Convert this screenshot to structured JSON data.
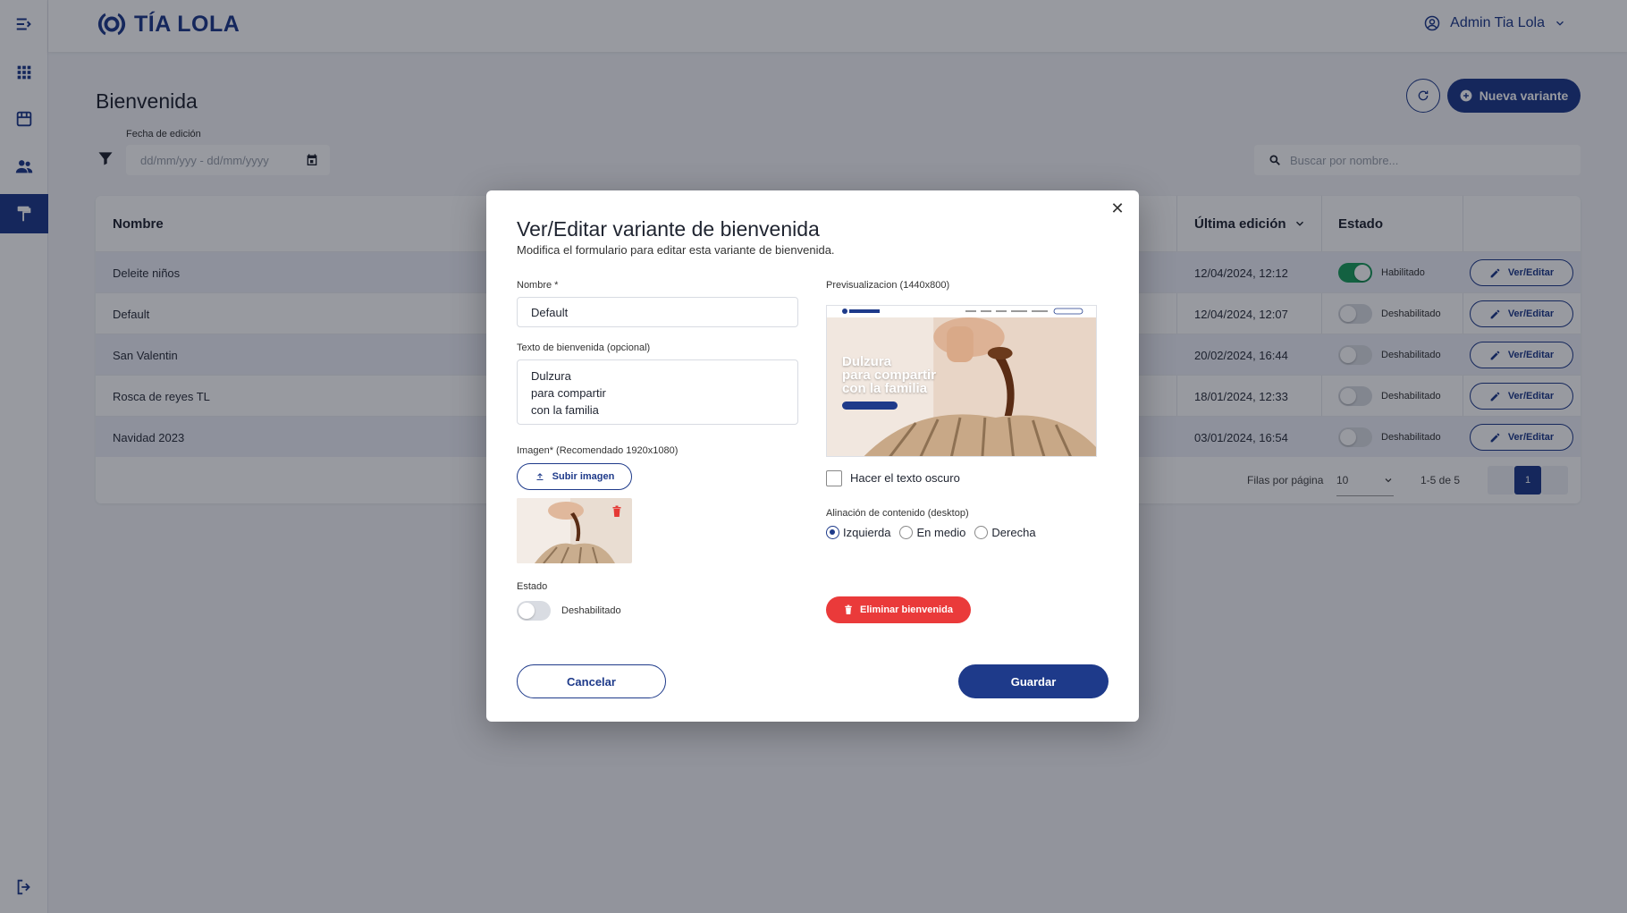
{
  "app": {
    "brand": "TÍA LOLA",
    "user_name": "Admin Tia Lola"
  },
  "sidebar": {
    "items": [
      {
        "icon": "menu-collapse-icon"
      },
      {
        "icon": "grid-icon"
      },
      {
        "icon": "store-icon"
      },
      {
        "icon": "users-icon"
      },
      {
        "icon": "paint-roller-icon",
        "active": true
      },
      {
        "icon": "logout-icon"
      }
    ]
  },
  "page": {
    "title": "Bienvenida",
    "new_button": "Nueva variante",
    "filter": {
      "date_label": "Fecha de edición",
      "date_placeholder": "dd/mm/yyy - dd/mm/yyyy"
    },
    "search_placeholder": "Buscar por nombre..."
  },
  "table": {
    "headers": {
      "name": "Nombre",
      "last_edit": "Última edición",
      "state": "Estado"
    },
    "rows": [
      {
        "name": "Deleite niños",
        "date": "12/04/2024, 12:12",
        "enabled": true,
        "status": "Habilitado",
        "action": "Ver/Editar"
      },
      {
        "name": "Default",
        "date": "12/04/2024, 12:07",
        "enabled": false,
        "status": "Deshabilitado",
        "action": "Ver/Editar"
      },
      {
        "name": "San Valentin",
        "date": "20/02/2024, 16:44",
        "enabled": false,
        "status": "Deshabilitado",
        "action": "Ver/Editar"
      },
      {
        "name": "Rosca de reyes TL",
        "date": "18/01/2024, 12:33",
        "enabled": false,
        "status": "Deshabilitado",
        "action": "Ver/Editar"
      },
      {
        "name": "Navidad 2023",
        "date": "03/01/2024, 16:54",
        "enabled": false,
        "status": "Deshabilitado",
        "action": "Ver/Editar"
      }
    ],
    "footer": {
      "rows_per_page_label": "Filas por página",
      "rows_per_page": "10",
      "range": "1-5 de 5",
      "current_page": "1"
    }
  },
  "modal": {
    "title": "Ver/Editar variante de bienvenida",
    "subtitle": "Modifica el formulario para editar esta variante de bienvenida.",
    "name_label": "Nombre *",
    "name_value": "Default",
    "text_label": "Texto de bienvenida (opcional)",
    "text_lines": [
      "Dulzura",
      "para compartir",
      "con la familia"
    ],
    "image_label": "Imagen* (Recomendado 1920x1080)",
    "upload_button": "Subir imagen",
    "state_label": "Estado",
    "state_text": "Deshabilitado",
    "preview_label": "Previsualizacion (1440x800)",
    "preview_text_lines": [
      "Dulzura",
      "para compartir",
      "con la familia"
    ],
    "dark_text_label": "Hacer el texto oscuro",
    "alignment_label": "Alinación de contenido (desktop)",
    "alignment_options": [
      "Izquierda",
      "En medio",
      "Derecha"
    ],
    "alignment_selected": "Izquierda",
    "delete_button": "Eliminar bienvenida",
    "cancel_button": "Cancelar",
    "save_button": "Guardar"
  },
  "colors": {
    "primary": "#1e3a8a",
    "danger": "#ea3a3a",
    "success": "#1a9e5c"
  }
}
